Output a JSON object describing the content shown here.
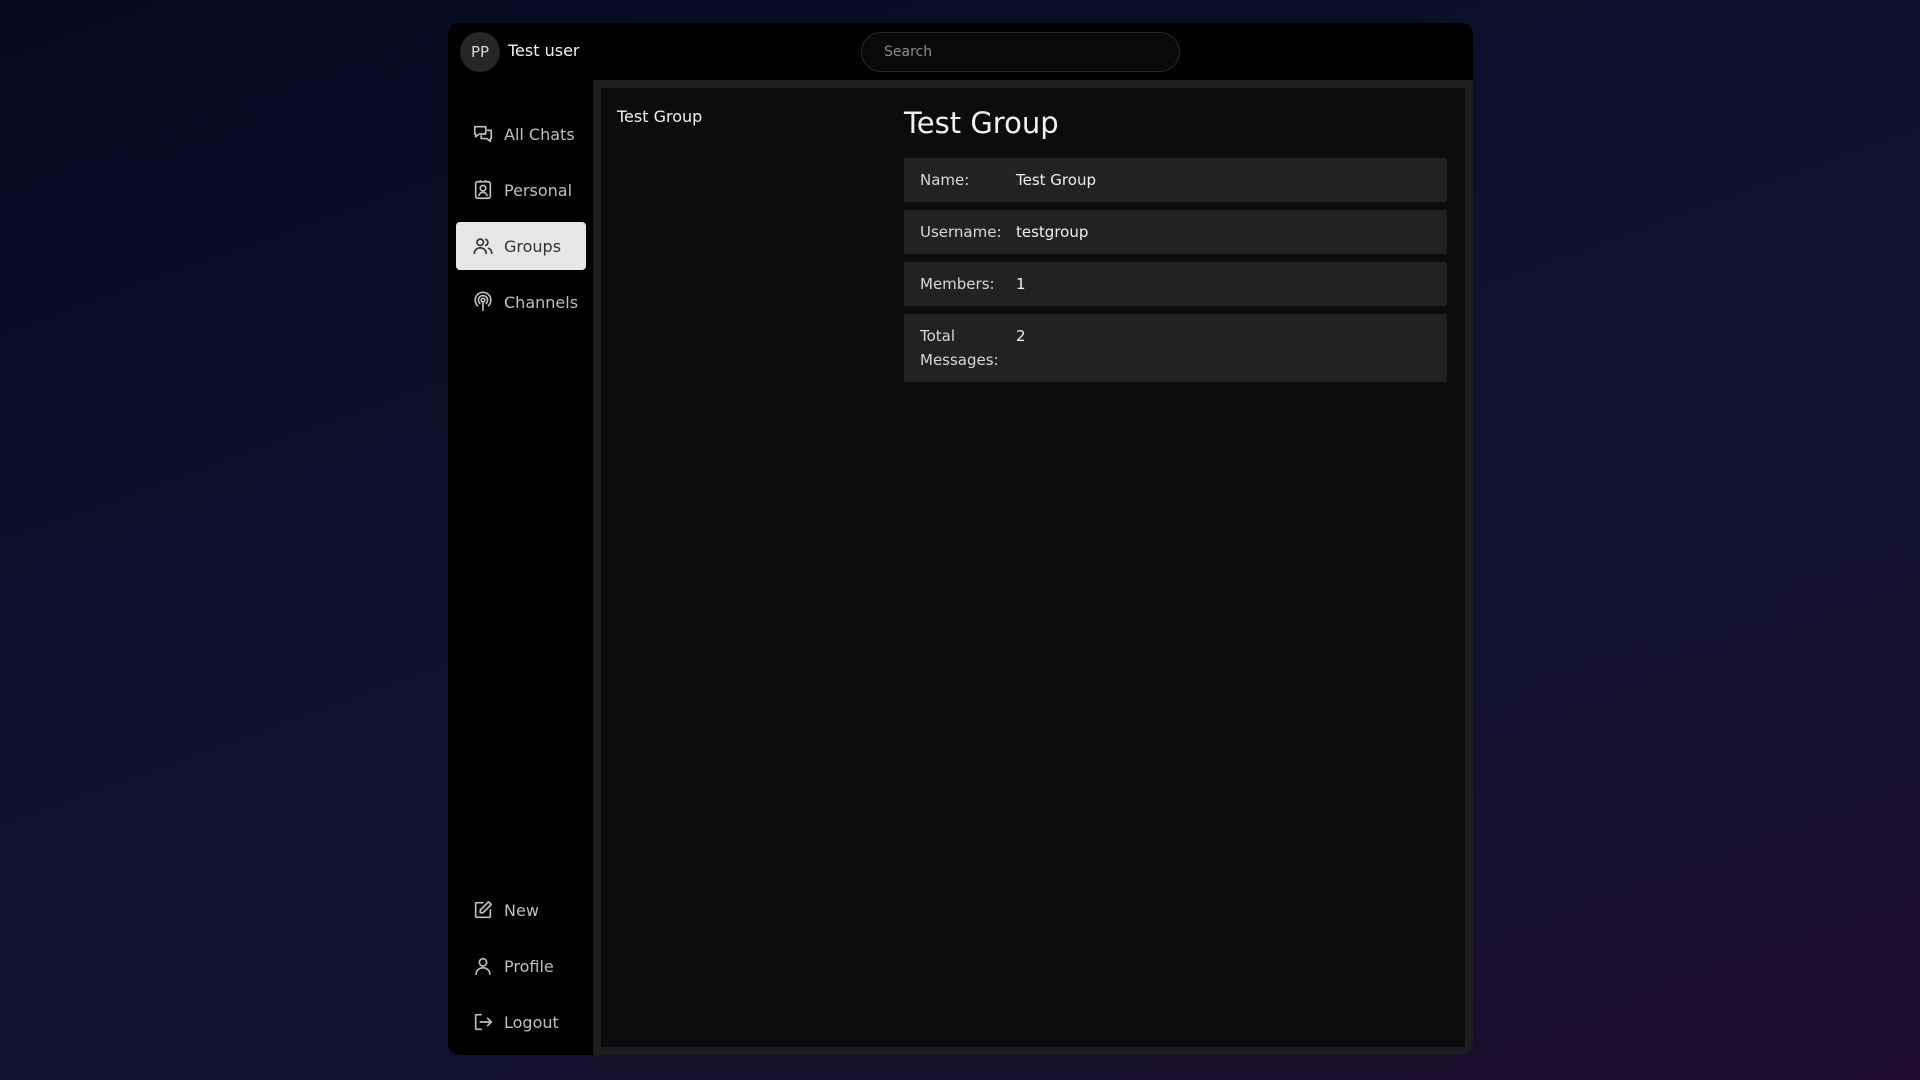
{
  "header": {
    "avatar_initials": "PP",
    "username": "Test user",
    "search_placeholder": "Search"
  },
  "sidebar": {
    "top_items": [
      {
        "label": "All Chats",
        "icon": "chat-bubbles-icon"
      },
      {
        "label": "Personal",
        "icon": "contact-card-icon"
      },
      {
        "label": "Groups",
        "icon": "users-icon",
        "active": true
      },
      {
        "label": "Channels",
        "icon": "broadcast-icon"
      }
    ],
    "bottom_items": [
      {
        "label": "New",
        "icon": "edit-icon"
      },
      {
        "label": "Profile",
        "icon": "user-icon"
      },
      {
        "label": "Logout",
        "icon": "logout-icon"
      }
    ]
  },
  "chat_list": {
    "items": [
      {
        "name": "Test Group"
      }
    ]
  },
  "detail": {
    "title": "Test Group",
    "rows": [
      {
        "label": "Name:",
        "value": "Test Group"
      },
      {
        "label": "Username:",
        "value": "testgroup"
      },
      {
        "label": "Members:",
        "value": "1"
      },
      {
        "label": "Total Messages:",
        "value": "2"
      }
    ]
  },
  "colors": {
    "active_nav_bg": "#e6e6e6",
    "row_bg": "#222222",
    "panel_bg": "#0c0c0e"
  }
}
